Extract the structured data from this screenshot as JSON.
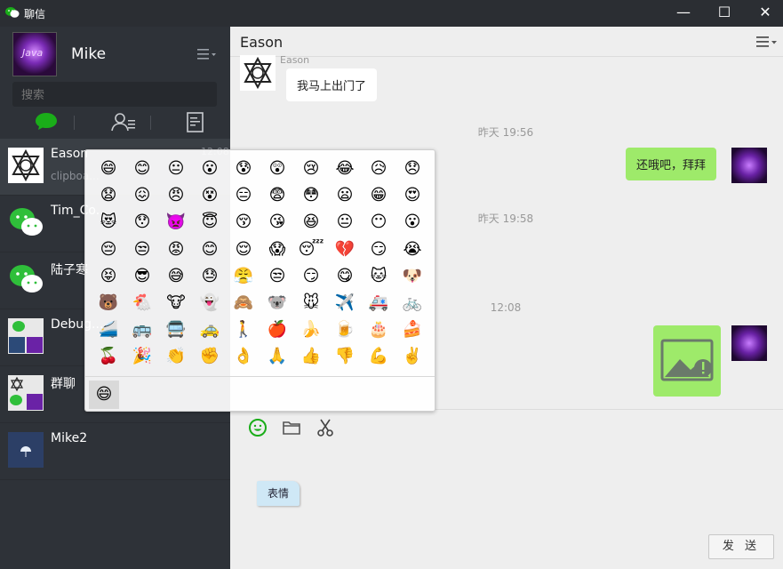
{
  "window": {
    "title": "聊信",
    "minimize": "—",
    "maximize": "☐",
    "close": "✕"
  },
  "profile": {
    "name": "Mike",
    "avatar_text": "Java"
  },
  "search": {
    "placeholder": "搜索"
  },
  "conversations": [
    {
      "name": "Eason",
      "preview": "clipboa...",
      "time": "12:08",
      "avatar": "seal"
    },
    {
      "name": "Tim_Co...",
      "preview": "",
      "time": "",
      "avatar": "wechat"
    },
    {
      "name": "陆子寒",
      "preview": "",
      "time": "",
      "avatar": "wechat"
    },
    {
      "name": "Debug...",
      "preview": "",
      "time": "",
      "avatar": "group"
    },
    {
      "name": "群聊",
      "preview": "",
      "time": "",
      "avatar": "group"
    },
    {
      "name": "Mike2",
      "preview": "",
      "time": "",
      "avatar": "night"
    }
  ],
  "chat": {
    "title": "Eason",
    "messages": [
      {
        "type": "in",
        "sender": "Eason",
        "text": "我马上出门了"
      },
      {
        "type": "time",
        "text": "昨天 19:56"
      },
      {
        "type": "out",
        "text": "还哦吧，拜拜"
      },
      {
        "type": "time",
        "text": "昨天 19:58"
      },
      {
        "type": "time",
        "text": "12:08"
      },
      {
        "type": "out-image",
        "text": ""
      }
    ]
  },
  "input": {
    "sticker_label": "表情",
    "send_label": "发 送"
  },
  "emoji_panel": {
    "emojis": [
      "😄",
      "😊",
      "😐",
      "😮",
      "😰",
      "😲",
      "😢",
      "😂",
      "😥",
      "😞",
      "😧",
      "😖",
      "😠",
      "😵",
      "😑",
      "😨",
      "😳",
      "😦",
      "😁",
      "😍",
      "😻",
      "😯",
      "👿",
      "😇",
      "😚",
      "😘",
      "😆",
      "😐",
      "😶",
      "😮",
      "😔",
      "😒",
      "😡",
      "😊",
      "😌",
      "😱",
      "😴",
      "💔",
      "😏",
      "😭",
      "😝",
      "😎",
      "😅",
      "😓",
      "😤",
      "😒",
      "😏",
      "😋",
      "🐱",
      "🐶",
      "🐻",
      "🐔",
      "🐮",
      "👻",
      "🙈",
      "🐨",
      "🐭",
      "✈️",
      "🚑",
      "🚲",
      "🚄",
      "🚌",
      "🚍",
      "🚕",
      "🚶",
      "🍎",
      "🍌",
      "🍺",
      "🎂",
      "🍰",
      "🍒",
      "🎉",
      "👏",
      "✊",
      "👌",
      "🙏",
      "👍",
      "👎",
      "💪",
      "✌️"
    ],
    "footer_tab": "😄"
  },
  "colors": {
    "sidebar_bg": "#2e3238",
    "chat_bg": "#eeeeee",
    "out_bubble": "#9eea6a",
    "accent_green": "#1aad19"
  }
}
